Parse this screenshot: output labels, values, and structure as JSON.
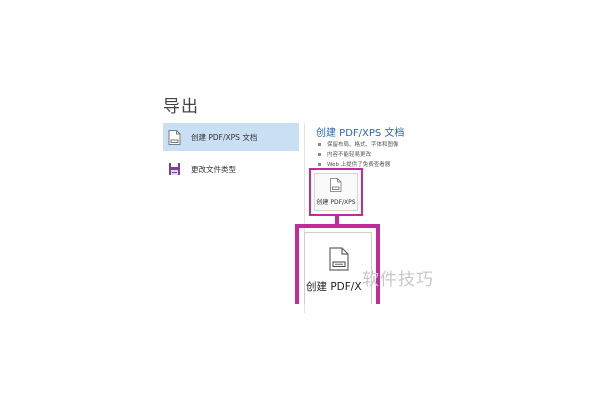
{
  "export": {
    "title": "导出"
  },
  "left_menu": {
    "items": [
      {
        "label": "创建 PDF/XPS 文档",
        "icon": "pdf-document-icon",
        "selected": true
      },
      {
        "label": "更改文件类型",
        "icon": "change-file-type-icon",
        "selected": false
      }
    ]
  },
  "right_panel": {
    "title": "创建 PDF/XPS 文档",
    "bullets": [
      "保留布局、格式、字体和图像",
      "内容不能轻易更改",
      "Web 上提供了免费查看器"
    ],
    "button_label": "创建 PDF/XPS",
    "zoomed_button_label": "创建 PDF/X"
  },
  "watermark": "软件技巧",
  "colors": {
    "highlight": "#c22b9c",
    "selected_bg": "#c9dff3",
    "section_title": "#2b64b2"
  }
}
